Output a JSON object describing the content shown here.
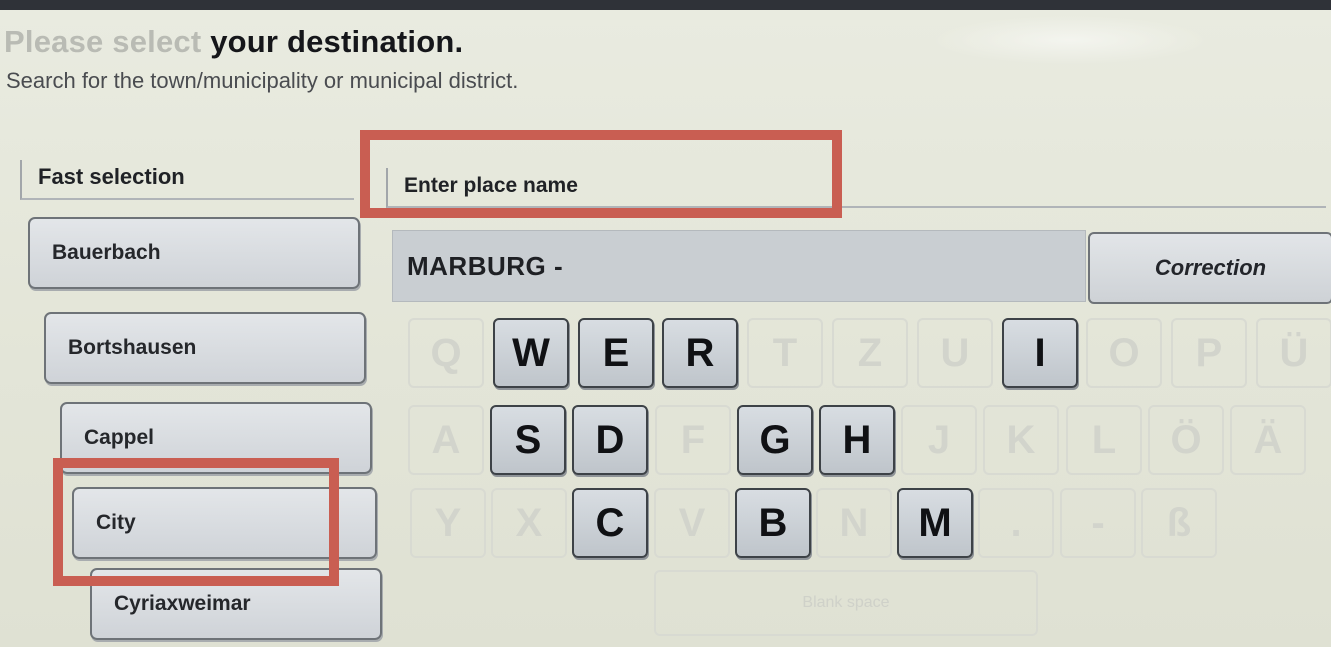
{
  "header": {
    "title_faded": "Please select",
    "title_rest": " your destination.",
    "subtitle": "Search for the town/municipality or municipal district."
  },
  "fast_selection": {
    "heading": "Fast selection",
    "items": [
      "Bauerbach",
      "Bortshausen",
      "Cappel",
      "City",
      "Cyriaxweimar"
    ]
  },
  "place_entry": {
    "heading": "Enter place name",
    "value": "MARBURG -",
    "correction_label": "Correction"
  },
  "keyboard": {
    "row1": [
      {
        "label": "Q",
        "enabled": false
      },
      {
        "label": "W",
        "enabled": true
      },
      {
        "label": "E",
        "enabled": true
      },
      {
        "label": "R",
        "enabled": true
      },
      {
        "label": "T",
        "enabled": false
      },
      {
        "label": "Z",
        "enabled": false
      },
      {
        "label": "U",
        "enabled": false
      },
      {
        "label": "I",
        "enabled": true
      },
      {
        "label": "O",
        "enabled": false
      },
      {
        "label": "P",
        "enabled": false
      },
      {
        "label": "Ü",
        "enabled": false
      }
    ],
    "row2": [
      {
        "label": "A",
        "enabled": false
      },
      {
        "label": "S",
        "enabled": true
      },
      {
        "label": "D",
        "enabled": true
      },
      {
        "label": "F",
        "enabled": false
      },
      {
        "label": "G",
        "enabled": true
      },
      {
        "label": "H",
        "enabled": true
      },
      {
        "label": "J",
        "enabled": false
      },
      {
        "label": "K",
        "enabled": false
      },
      {
        "label": "L",
        "enabled": false
      },
      {
        "label": "Ö",
        "enabled": false
      },
      {
        "label": "Ä",
        "enabled": false
      }
    ],
    "row3": [
      {
        "label": "Y",
        "enabled": false
      },
      {
        "label": "X",
        "enabled": false
      },
      {
        "label": "C",
        "enabled": true
      },
      {
        "label": "V",
        "enabled": false
      },
      {
        "label": "B",
        "enabled": true
      },
      {
        "label": "N",
        "enabled": false
      },
      {
        "label": "M",
        "enabled": true
      },
      {
        "label": ".",
        "enabled": false
      },
      {
        "label": "-",
        "enabled": false
      },
      {
        "label": "ß",
        "enabled": false
      }
    ],
    "space_label": "Blank space"
  },
  "colors": {
    "highlight": "#c95e52"
  }
}
